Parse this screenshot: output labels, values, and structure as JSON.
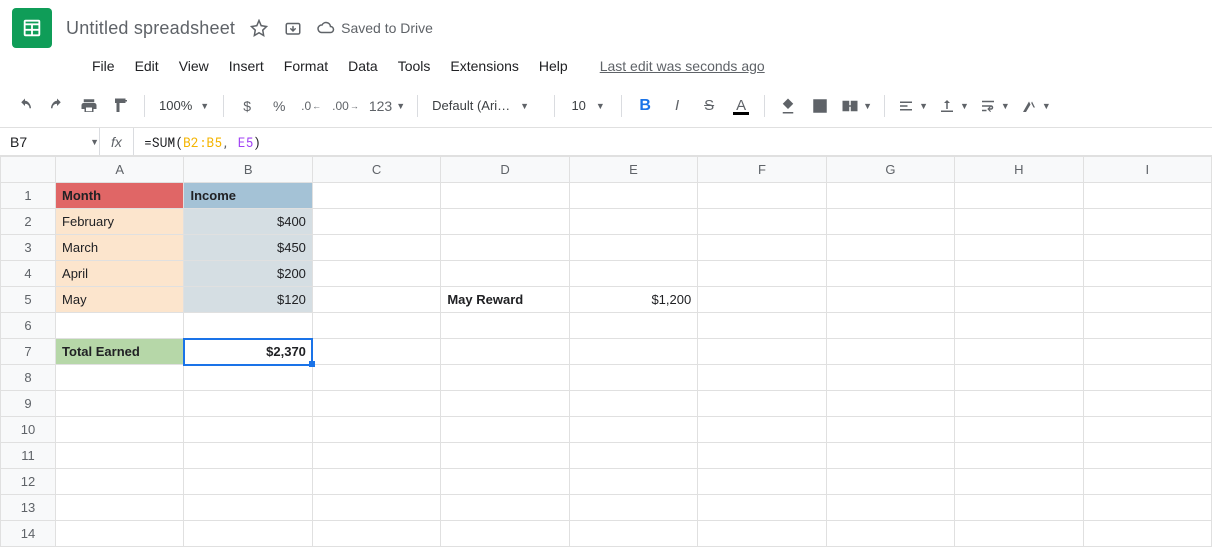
{
  "doc": {
    "title": "Untitled spreadsheet",
    "saved": "Saved to Drive"
  },
  "menu": {
    "file": "File",
    "edit": "Edit",
    "view": "View",
    "insert": "Insert",
    "format": "Format",
    "data": "Data",
    "tools": "Tools",
    "extensions": "Extensions",
    "help": "Help",
    "last_edit": "Last edit was seconds ago"
  },
  "toolbar": {
    "zoom": "100%",
    "currency": "$",
    "percent": "%",
    "dec_dec": ".0",
    "inc_dec": ".00",
    "num_fmt": "123",
    "font": "Default (Ari…",
    "size": "10",
    "bold": "B",
    "italic": "I",
    "strike": "S",
    "tcolor": "A"
  },
  "fx": {
    "namebox": "B7",
    "prefix": "=SUM(",
    "ref1": "B2:B5",
    "comma": ", ",
    "ref2": "E5",
    "suffix": ")"
  },
  "cols": {
    "A": "A",
    "B": "B",
    "C": "C",
    "D": "D",
    "E": "E",
    "F": "F",
    "G": "G",
    "H": "H",
    "I": "I"
  },
  "rows": {
    "1": "1",
    "2": "2",
    "3": "3",
    "4": "4",
    "5": "5",
    "6": "6",
    "7": "7",
    "8": "8",
    "9": "9",
    "10": "10",
    "11": "11",
    "12": "12",
    "13": "13",
    "14": "14"
  },
  "cells": {
    "A1": "Month",
    "B1": "Income",
    "A2": "February",
    "B2": "$400",
    "A3": "March",
    "B3": "$450",
    "A4": "April",
    "B4": "$200",
    "A5": "May",
    "B5": "$120",
    "D5": "May Reward",
    "E5": "$1,200",
    "A7": "Total Earned",
    "B7": "$2,370"
  }
}
